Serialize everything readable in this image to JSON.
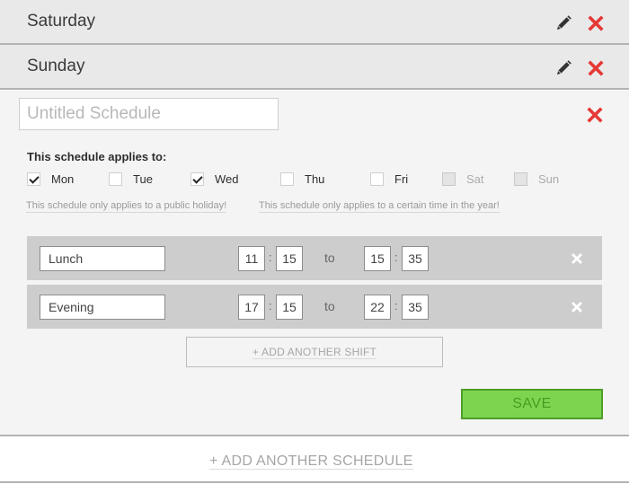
{
  "day_rows": [
    {
      "label": "Saturday"
    },
    {
      "label": "Sunday"
    }
  ],
  "editor": {
    "title_value": "",
    "title_placeholder": "Untitled Schedule",
    "applies_label": "This schedule applies to:",
    "days": [
      {
        "label": "Mon",
        "checked": true,
        "disabled": false
      },
      {
        "label": "Tue",
        "checked": false,
        "disabled": false
      },
      {
        "label": "Wed",
        "checked": true,
        "disabled": false
      },
      {
        "label": "Thu",
        "checked": false,
        "disabled": false
      },
      {
        "label": "Fri",
        "checked": false,
        "disabled": false
      },
      {
        "label": "Sat",
        "checked": false,
        "disabled": true
      },
      {
        "label": "Sun",
        "checked": false,
        "disabled": true
      }
    ],
    "hint_holiday": "This schedule only applies to a public holiday!",
    "hint_time_of_year": "This schedule only applies to a certain time in the year!",
    "shifts": [
      {
        "name": "Lunch",
        "start_hour": "11",
        "start_min": "15",
        "end_hour": "15",
        "end_min": "35"
      },
      {
        "name": "Evening",
        "start_hour": "17",
        "start_min": "15",
        "end_hour": "22",
        "end_min": "35"
      }
    ],
    "time_separator": ":",
    "to_label": "to",
    "add_shift_label": "+ ADD ANOTHER SHIFT",
    "save_label": "SAVE"
  },
  "add_schedule_label": "+ ADD ANOTHER SCHEDULE",
  "colors": {
    "delete_red": "#e53935",
    "save_green": "#7dd54f",
    "save_border": "#4e9e27",
    "shift_bg": "#cdcdcd",
    "row_bg": "#e9e9e9"
  },
  "icons": {
    "edit": "pencil-icon",
    "delete": "close-icon"
  }
}
